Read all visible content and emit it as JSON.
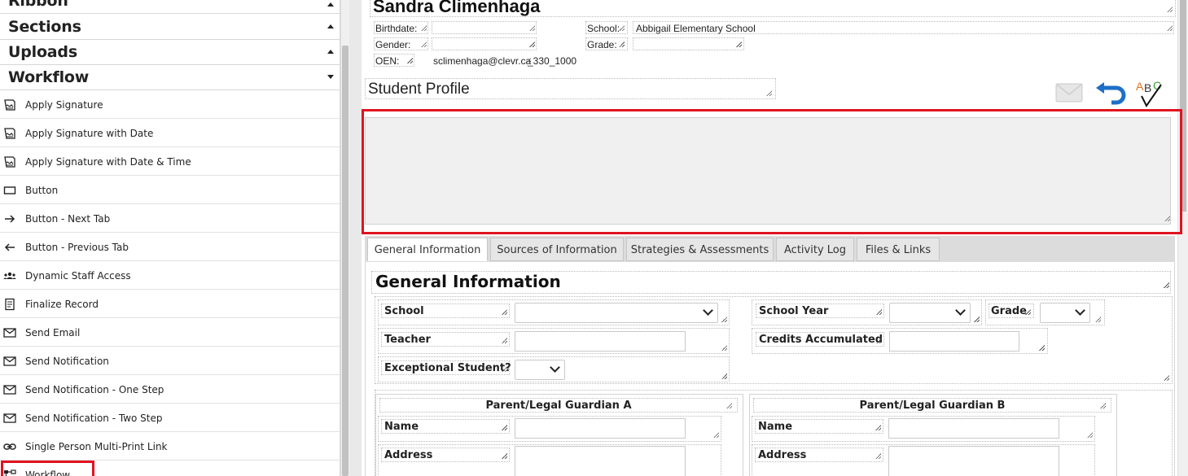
{
  "sidebar": {
    "sections": [
      {
        "label": "Ribbon",
        "state": "collapsed"
      },
      {
        "label": "Sections",
        "state": "collapsed"
      },
      {
        "label": "Uploads",
        "state": "collapsed"
      },
      {
        "label": "Workflow",
        "state": "expanded"
      }
    ],
    "workflow_items": [
      {
        "label": "Apply Signature",
        "icon": "signature-icon"
      },
      {
        "label": "Apply Signature with Date",
        "icon": "signature-icon"
      },
      {
        "label": "Apply Signature with Date & Time",
        "icon": "signature-icon"
      },
      {
        "label": "Button",
        "icon": "button-icon"
      },
      {
        "label": "Button - Next Tab",
        "icon": "arrow-right-icon"
      },
      {
        "label": "Button - Previous Tab",
        "icon": "arrow-left-icon"
      },
      {
        "label": "Dynamic Staff Access",
        "icon": "people-icon"
      },
      {
        "label": "Finalize Record",
        "icon": "document-icon"
      },
      {
        "label": "Send Email",
        "icon": "envelope-icon"
      },
      {
        "label": "Send Notification",
        "icon": "envelope-icon"
      },
      {
        "label": "Send Notification - One Step",
        "icon": "envelope-icon"
      },
      {
        "label": "Send Notification - Two Step",
        "icon": "envelope-icon"
      },
      {
        "label": "Single Person Multi-Print Link",
        "icon": "link-icon"
      },
      {
        "label": "Workflow",
        "icon": "workflow-icon"
      }
    ]
  },
  "student": {
    "name": "Sandra Climenhaga",
    "birthdate_label": "Birthdate:",
    "birthdate_value": "",
    "gender_label": "Gender:",
    "gender_value": "",
    "oen_label": "OEN:",
    "email_value": "sclimenhaga@clevr.ca",
    "id_value": "_330_1000",
    "school_label": "School:",
    "school_value": "Abbigail Elementary School",
    "grade_label": "Grade:",
    "grade_value": ""
  },
  "profile": {
    "title": "Student Profile",
    "text": ""
  },
  "tabs": [
    {
      "label": "General Information",
      "active": true
    },
    {
      "label": "Sources of Information",
      "active": false
    },
    {
      "label": "Strategies & Assessments",
      "active": false
    },
    {
      "label": "Activity Log",
      "active": false
    },
    {
      "label": "Files & Links",
      "active": false
    }
  ],
  "general": {
    "title": "General Information",
    "school_label": "School",
    "school_value": "",
    "school_year_label": "School Year",
    "school_year_value": "",
    "grade_label": "Grade",
    "grade_value": "",
    "teacher_label": "Teacher",
    "teacher_value": "",
    "credits_label": "Credits Accumulated",
    "credits_value": "",
    "exceptional_label": "Exceptional Student?",
    "exceptional_value": ""
  },
  "guardians": [
    {
      "title": "Parent/Legal Guardian A",
      "name_label": "Name",
      "name_value": "",
      "address_label": "Address",
      "address_value": ""
    },
    {
      "title": "Parent/Legal Guardian B",
      "name_label": "Name",
      "name_value": "",
      "address_label": "Address",
      "address_value": ""
    }
  ],
  "colors": {
    "highlight": "#e0131f",
    "undo_blue": "#1e6fc7",
    "spell_orange": "#e0731f",
    "spell_green": "#3aa13a"
  }
}
